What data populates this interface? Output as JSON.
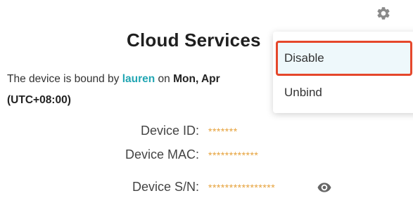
{
  "header": {
    "title": "Cloud Services",
    "settings_icon": "gear-icon"
  },
  "binding": {
    "prefix": "The device is bound by ",
    "user": "lauren",
    "middle": " on ",
    "date": "Mon, Apr",
    "timezone": "(UTC+08:00)"
  },
  "device_info": [
    {
      "label": "Device ID:",
      "value": "*******"
    },
    {
      "label": "Device MAC:",
      "value": "************"
    },
    {
      "label": "Device S/N:",
      "value": "****************"
    }
  ],
  "reveal_icon": "eye-icon",
  "menu": {
    "items": [
      {
        "label": "Disable"
      },
      {
        "label": "Unbind"
      }
    ]
  },
  "colors": {
    "accent": "#22a6b3",
    "masked_value": "#e6a23c",
    "highlight_border": "#e5472b"
  }
}
